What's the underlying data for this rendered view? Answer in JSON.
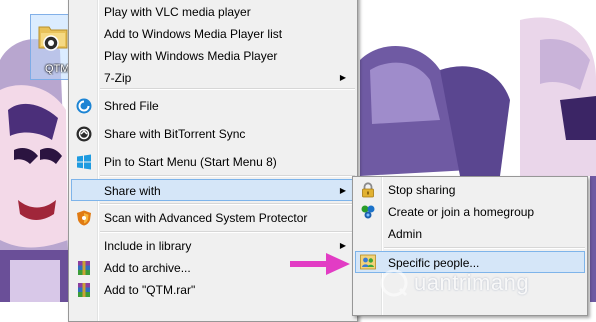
{
  "desktop": {
    "icon_label": "QTM",
    "watermark": "uantrimang"
  },
  "context_menu": {
    "items": [
      {
        "label": "Play with VLC media player",
        "icon": ""
      },
      {
        "label": "Add to Windows Media Player list",
        "icon": ""
      },
      {
        "label": "Play with Windows Media Player",
        "icon": ""
      },
      {
        "label": "7-Zip",
        "icon": "",
        "has_submenu": true
      },
      {
        "label": "Shred File",
        "icon": "shred-icon"
      },
      {
        "label": "Share with BitTorrent Sync",
        "icon": "bittorrent-sync-icon"
      },
      {
        "label": "Pin to Start Menu (Start Menu 8)",
        "icon": "windows-logo-icon"
      },
      {
        "label": "Share with",
        "icon": "",
        "has_submenu": true,
        "highlighted": true
      },
      {
        "label": "Scan with Advanced System Protector",
        "icon": "shield-icon"
      },
      {
        "label": "Include in library",
        "icon": "",
        "has_submenu": true
      },
      {
        "label": "Add to archive...",
        "icon": "winrar-icon"
      },
      {
        "label": "Add to \"QTM.rar\"",
        "icon": "winrar-icon"
      }
    ],
    "submenu_arrow": "▶"
  },
  "share_with_submenu": {
    "items": [
      {
        "label": "Stop sharing",
        "icon": "lock-icon"
      },
      {
        "label": "Create or join a homegroup",
        "icon": "homegroup-icon"
      },
      {
        "label": "Admin",
        "icon": ""
      },
      {
        "label": "Specific people...",
        "icon": "people-icon",
        "highlighted": true
      }
    ]
  },
  "colors": {
    "menu_background": "#f0f0f0",
    "highlight_fill": "#d5e6f8",
    "highlight_border": "#7eb4ea",
    "pointer_arrow": "#e23cc4"
  }
}
